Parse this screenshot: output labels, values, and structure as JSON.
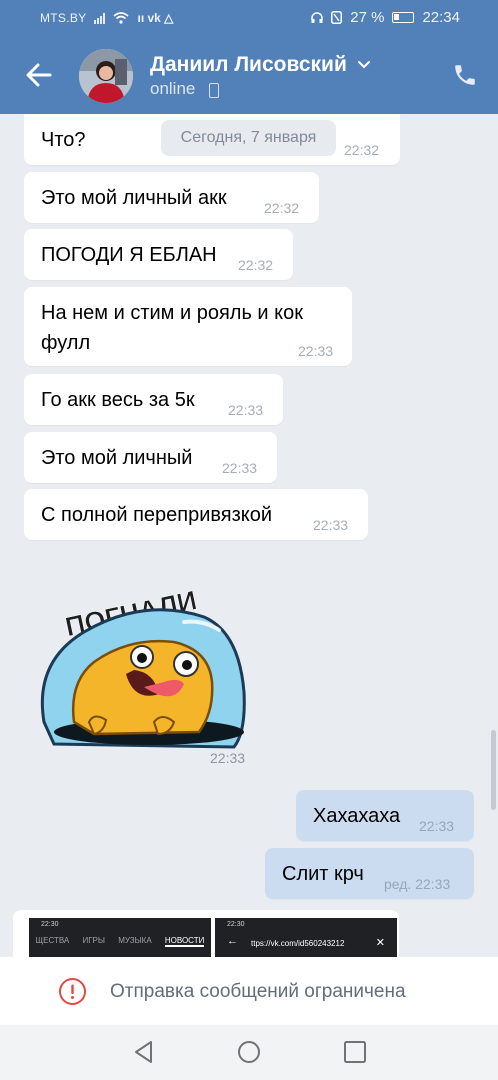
{
  "status_bar": {
    "carrier": "MTS.BY",
    "app_icons": "ıı vk △",
    "battery": "27 %",
    "time": "22:34"
  },
  "header": {
    "name": "Даниил Лисовский",
    "status": "online"
  },
  "date_divider": "Сегодня, 7 января",
  "messages": [
    {
      "text": "Что?",
      "time": "22:32"
    },
    {
      "text": "Это мой личный акк",
      "time": "22:32"
    },
    {
      "text": "ПОГОДИ Я ЕБЛАН",
      "time": "22:32"
    },
    {
      "text_line1": "На нем и стим и рояль и кок",
      "text_line2": "фулл",
      "time": "22:33"
    },
    {
      "text": "Го акк весь за 5к",
      "time": "22:33"
    },
    {
      "text": "Это мой личный",
      "time": "22:33"
    },
    {
      "text": "С полной перепривязкой",
      "time": "22:33"
    }
  ],
  "sticker": {
    "text": "ПОГНАЛИ",
    "time": "22:33"
  },
  "outgoing": [
    {
      "text": "Хахахаха",
      "time": "22:33"
    },
    {
      "text": "Слит крч",
      "time": "ред. 22:33"
    }
  ],
  "preview": {
    "left_time": "22:30",
    "right_time": "22:30",
    "tabs": [
      "ЩЕСТВА",
      "ИГРЫ",
      "МУЗЫКА",
      "НОВОСТИ"
    ],
    "url": "ttps://vk.com/id560243212"
  },
  "notice": "Отправка сообщений ограничена",
  "colors": {
    "header": "#5181b8",
    "outgoing_bubble": "#ccdcf0",
    "background": "#e9edf2"
  }
}
